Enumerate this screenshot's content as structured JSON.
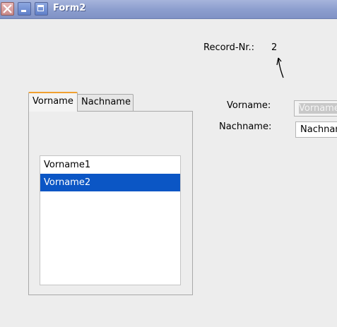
{
  "window": {
    "title": "Form2"
  },
  "record": {
    "label": "Record-Nr.:",
    "value": "2"
  },
  "tabs": [
    {
      "label": "Vorname",
      "active": true
    },
    {
      "label": "Nachname",
      "active": false
    }
  ],
  "list": {
    "items": [
      {
        "label": "Vorname1",
        "selected": false
      },
      {
        "label": "Vorname2",
        "selected": true
      }
    ]
  },
  "form": {
    "vorname_label": "Vorname:",
    "vorname_value": "Vorname",
    "nachname_label": "Nachname:",
    "nachname_value": "Nachname"
  },
  "colors": {
    "selection": "#0b56c5",
    "active_tab_accent": "#f0a030",
    "titlebar": "#8d9fcf"
  }
}
